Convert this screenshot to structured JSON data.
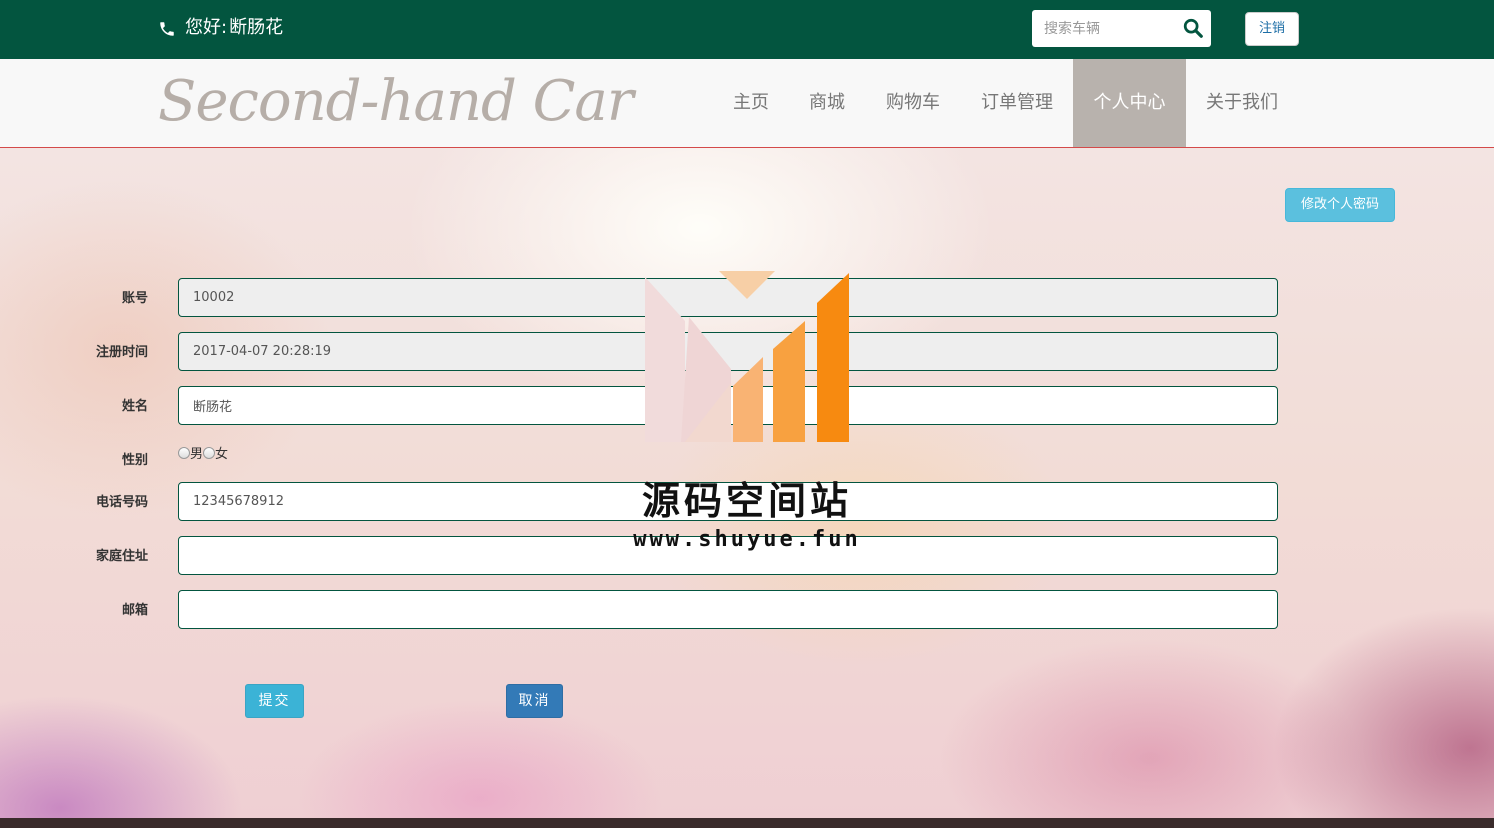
{
  "header": {
    "greeting_prefix": "您好:",
    "username": "断肠花",
    "search_placeholder": "搜索车辆",
    "logout_label": "注销"
  },
  "brand": {
    "logo_text": "Second-hand Car"
  },
  "nav": {
    "items": [
      {
        "label": "主页"
      },
      {
        "label": "商城"
      },
      {
        "label": "购物车"
      },
      {
        "label": "订单管理"
      },
      {
        "label": "个人中心",
        "active": true
      },
      {
        "label": "关于我们"
      }
    ]
  },
  "profile": {
    "change_password_label": "修改个人密码",
    "fields": {
      "account": {
        "label": "账号",
        "value": "10002"
      },
      "register_time": {
        "label": "注册时间",
        "value": "2017-04-07 20:28:19"
      },
      "name": {
        "label": "姓名",
        "value": "断肠花"
      },
      "gender": {
        "label": "性别",
        "options": [
          "男",
          "女"
        ]
      },
      "phone": {
        "label": "电话号码",
        "value": "12345678912"
      },
      "address": {
        "label": "家庭住址",
        "value": ""
      },
      "email": {
        "label": "邮箱",
        "value": ""
      }
    },
    "submit_label": "提交",
    "cancel_label": "取消"
  },
  "watermark": {
    "title": "源码空间站",
    "url": "www.shuyue.fun"
  },
  "colors": {
    "header_bg": "#03553f",
    "active_nav_bg": "#b8b2ad",
    "info_button": "#5bc0de",
    "primary_button": "#337ab7"
  }
}
